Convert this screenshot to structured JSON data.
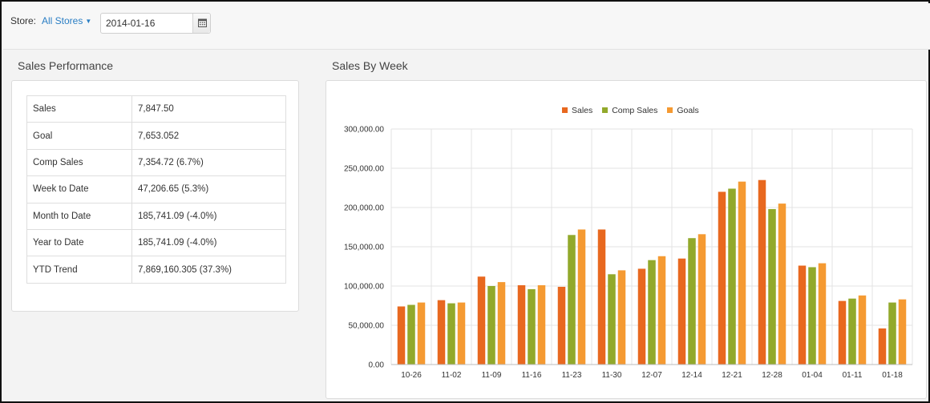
{
  "toolbar": {
    "store_label": "Store:",
    "store_value": "All Stores",
    "date_value": "2014-01-16",
    "calendar_icon": "calendar-icon",
    "caret_icon": "caret-down-icon"
  },
  "performance": {
    "title": "Sales Performance",
    "rows": [
      {
        "label": "Sales",
        "value": "7,847.50"
      },
      {
        "label": "Goal",
        "value": "7,653.052"
      },
      {
        "label": "Comp Sales",
        "value": "7,354.72 (6.7%)"
      },
      {
        "label": "Week to Date",
        "value": "47,206.65 (5.3%)"
      },
      {
        "label": "Month to Date",
        "value": "185,741.09 (-4.0%)"
      },
      {
        "label": "Year to Date",
        "value": "185,741.09 (-4.0%)"
      },
      {
        "label": "YTD Trend",
        "value": "7,869,160.305 (37.3%)"
      }
    ]
  },
  "sales_by_week": {
    "title": "Sales By Week"
  },
  "chart_data": {
    "type": "bar",
    "legend_position": "top-center",
    "grid": true,
    "categories": [
      "10-26",
      "11-02",
      "11-09",
      "11-16",
      "11-23",
      "11-30",
      "12-07",
      "12-14",
      "12-21",
      "12-28",
      "01-04",
      "01-11",
      "01-18"
    ],
    "ylim": [
      0,
      300000
    ],
    "yticks": [
      "0.00",
      "50,000.00",
      "100,000.00",
      "150,000.00",
      "200,000.00",
      "250,000.00",
      "300,000.00"
    ],
    "ytick_values": [
      0,
      50000,
      100000,
      150000,
      200000,
      250000,
      300000
    ],
    "series": [
      {
        "name": "Sales",
        "color": "#e8681f",
        "values": [
          74000,
          82000,
          112000,
          101000,
          99000,
          172000,
          122000,
          135000,
          220000,
          235000,
          126000,
          81000,
          46000
        ]
      },
      {
        "name": "Comp Sales",
        "color": "#92a92b",
        "values": [
          76000,
          78000,
          100000,
          96000,
          165000,
          115000,
          133000,
          161000,
          224000,
          198000,
          124000,
          84000,
          79000
        ]
      },
      {
        "name": "Goals",
        "color": "#f59a32",
        "values": [
          79000,
          79000,
          105000,
          101000,
          172000,
          120000,
          138000,
          166000,
          233000,
          205000,
          129000,
          88000,
          83000
        ]
      }
    ]
  }
}
